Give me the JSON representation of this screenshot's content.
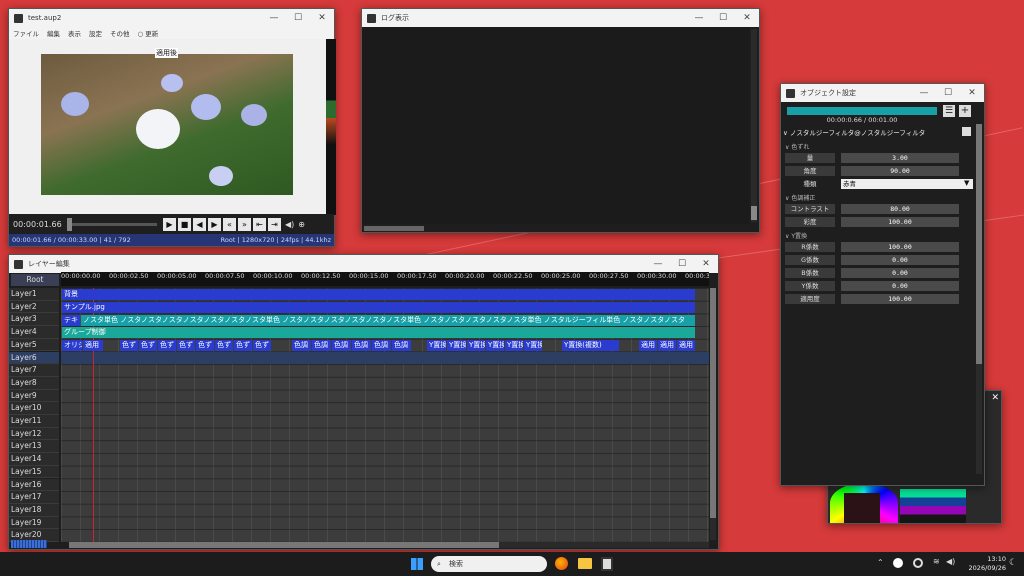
{
  "preview": {
    "title": "test.aup2",
    "menu": [
      "ファイル",
      "編集",
      "表示",
      "設定",
      "その他",
      "更新"
    ],
    "overlay_label": "適用後",
    "time": "00:00:01.66",
    "status": "00:00:01.66 / 00:00:33.00  |  41 / 792",
    "status_right": "Root  |  1280x720  |  24fps  |  44.1khz"
  },
  "log": {
    "title": "ログ表示"
  },
  "timeline": {
    "title": "レイヤー編集",
    "root_label": "Root",
    "ticks": [
      "00:00:00.00",
      "00:00:02.50",
      "00:00:05.00",
      "00:00:07.50",
      "00:00:10.00",
      "00:00:12.50",
      "00:00:15.00",
      "00:00:17.50",
      "00:00:20.00",
      "00:00:22.50",
      "00:00:25.00",
      "00:00:27.50",
      "00:00:30.00",
      "00:00:32"
    ],
    "layers": [
      "Layer1",
      "Layer2",
      "Layer3",
      "Layer4",
      "Layer5",
      "Layer6",
      "Layer7",
      "Layer8",
      "Layer9",
      "Layer10",
      "Layer11",
      "Layer12",
      "Layer13",
      "Layer14",
      "Layer15",
      "Layer16",
      "Layer17",
      "Layer18",
      "Layer19",
      "Layer20"
    ],
    "clips": {
      "layer1": "背景",
      "layer2": "サンプル.jpg",
      "layer3_a": "テキ",
      "layer3_b": "ノスタ単色 ノスタノスタノスタノスタノスタノスタノスタ単色 ノスタノスタノスタノスタノスタノスタ単色 ノスタノスタノスタノスタノスタ単色 ノスタルジーフィル単色 ノスタノスタノスタ",
      "layer4": "グループ制御",
      "layer5": [
        "オリジ",
        "適用",
        "色ず",
        "色ず",
        "色ず",
        "色ず",
        "色ず",
        "色ず",
        "色ず",
        "色ず",
        "色調",
        "色調",
        "色調",
        "色調",
        "色調",
        "色調",
        "Y置換",
        "Y置換",
        "Y置換",
        "Y置換",
        "Y置換",
        "Y置換",
        "Y置換(複数)",
        "適用",
        "適用",
        "適用"
      ]
    }
  },
  "object": {
    "title": "オブジェクト設定",
    "time": "00:00:0.66 / 00:01.00",
    "filter_title": "ノスタルジーフィルタ@ノスタルジーフィルタ",
    "sections": {
      "s1": "色ずれ",
      "s2": "色調補正",
      "s3": "Y置換"
    },
    "props": {
      "amount_label": "量",
      "amount_value": "3.00",
      "angle_label": "角度",
      "angle_value": "90.00",
      "type_label": "種類",
      "type_value": "赤青",
      "contrast_label": "コントラスト",
      "contrast_value": "80.00",
      "saturation_label": "彩度",
      "saturation_value": "100.00",
      "r_label": "R係数",
      "r_value": "100.00",
      "g_label": "G係数",
      "g_value": "0.00",
      "b_label": "B係数",
      "b_value": "0.00",
      "y_label": "Y係数",
      "y_value": "0.00",
      "apply_label": "適用度",
      "apply_value": "100.00"
    }
  },
  "taskbar": {
    "search": "検索",
    "clock_time": "13:10",
    "clock_date": "2026/09/26"
  },
  "colors": {
    "desktop": "#d63a3a",
    "clip_blue": "#2a3ccf",
    "clip_teal": "#17a0a8",
    "clip_green": "#1aa89a"
  }
}
